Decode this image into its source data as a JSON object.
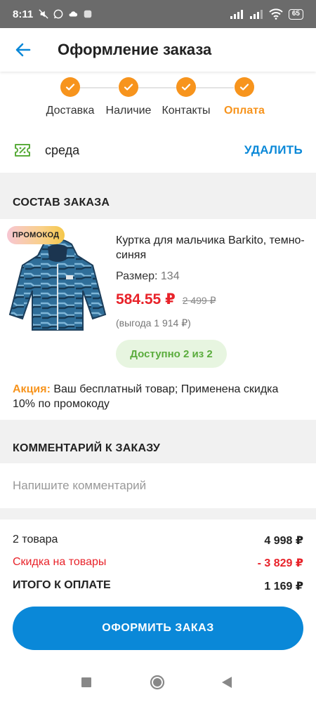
{
  "status_bar": {
    "time": "8:11",
    "battery": "65"
  },
  "header": {
    "title": "Оформление заказа",
    "back_icon": "arrow-left-icon"
  },
  "stepper": {
    "steps": [
      {
        "label": "Доставка",
        "done": true
      },
      {
        "label": "Наличие",
        "done": true
      },
      {
        "label": "Контакты",
        "done": true
      },
      {
        "label": "Оплата",
        "done": true,
        "active": true
      }
    ]
  },
  "promo": {
    "code": "среда",
    "delete_label": "УДАЛИТЬ",
    "icon": "ticket-percent-icon"
  },
  "order": {
    "section_title": "СОСТАВ ЗАКАЗА",
    "item": {
      "badge": "ПРОМОКОД",
      "name": "Куртка для мальчика Barkito, темно-синяя",
      "size_label": "Размер:",
      "size_value": "134",
      "price": "584.55 ₽",
      "old_price": "2 499 ₽",
      "saving": "(выгода 1 914 ₽)",
      "availability": "Доступно 2 из 2"
    },
    "action_label": "Акция:",
    "action_text": " Ваш бесплатный товар; Применена скидка 10% по промокоду"
  },
  "comment": {
    "section_title": "КОММЕНТАРИЙ К ЗАКАЗУ",
    "placeholder": "Напишите комментарий"
  },
  "summary": {
    "items_label": "2 товара",
    "items_value": "4 998 ₽",
    "discount_label": "Скидка на товары",
    "discount_value": "- 3 829 ₽",
    "total_label": "ИТОГО К ОПЛАТЕ",
    "total_value": "1 169 ₽"
  },
  "checkout_button": "ОФОРМИТЬ ЗАКАЗ",
  "colors": {
    "accent": "#f7941d",
    "primary": "#0a88d8",
    "discount": "#e8232a",
    "available": "#5aac3c"
  }
}
